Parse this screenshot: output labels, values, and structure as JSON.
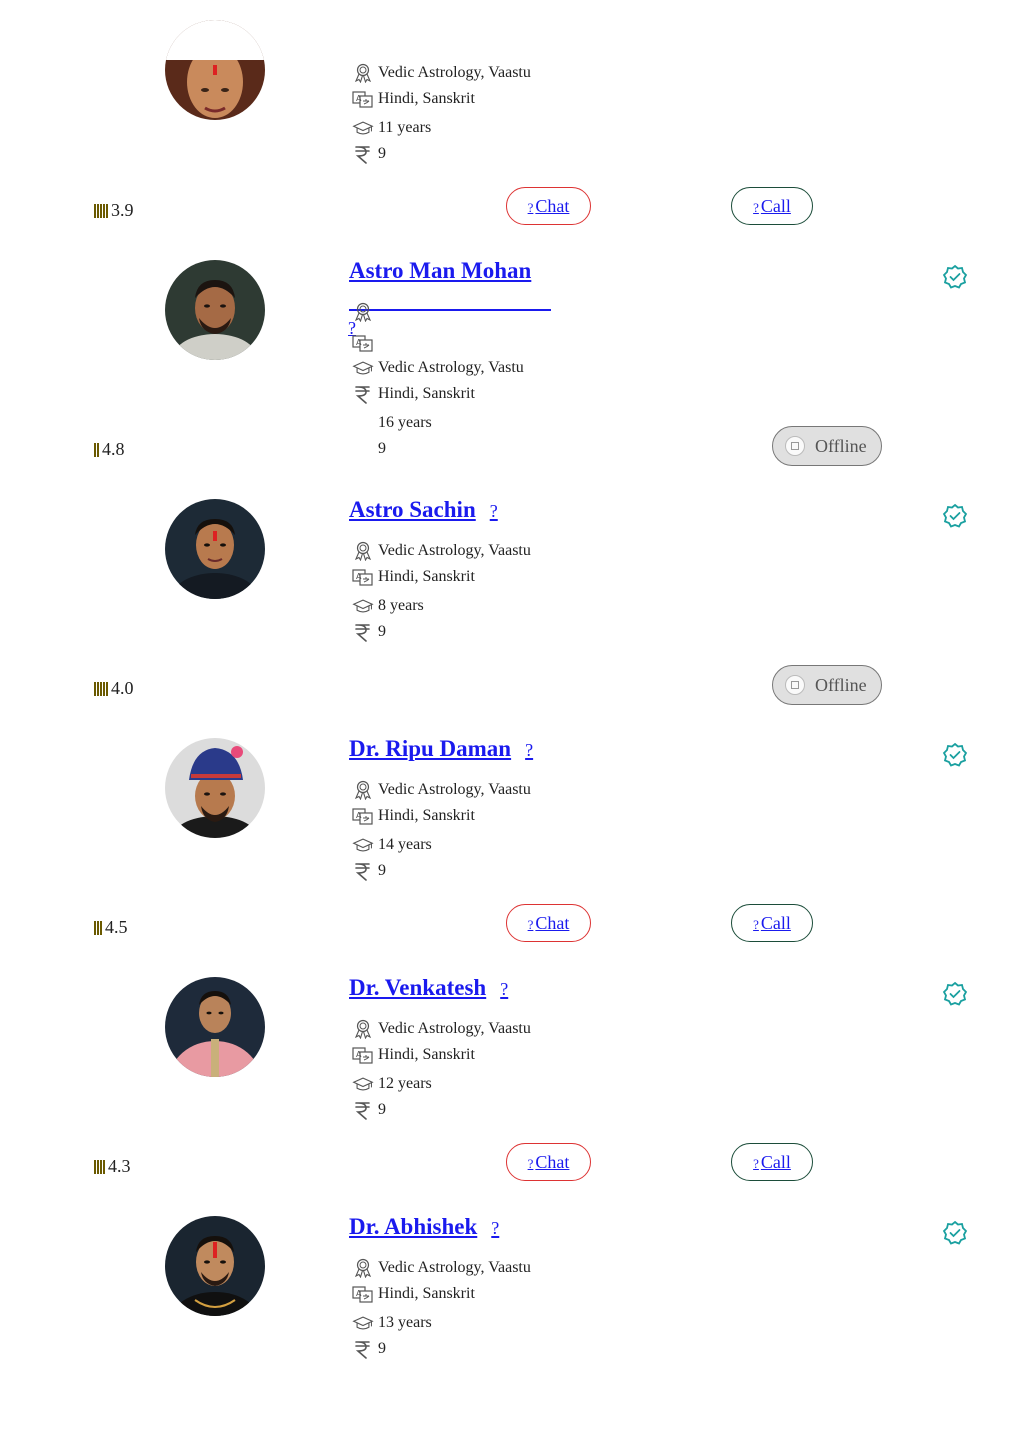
{
  "glyphs": {
    "tofu": "?"
  },
  "colors": {
    "link": "#1a1aee",
    "chat_border": "#dd3333",
    "call_border": "#1c4d3a",
    "verified": "#1aa0a0",
    "offline_bg": "#e0e0e0"
  },
  "card0": {
    "specialty": "Vedic Astrology, Vaastu",
    "languages": "Hindi, Sanskrit",
    "experience": "11 years",
    "price": "9",
    "rating": "3.9",
    "chat_label": "Chat",
    "call_label": "Call"
  },
  "card1": {
    "name": "Astro Man Mohan",
    "specialty": "Vedic Astrology, Vastu",
    "languages": "Hindi, Sanskrit",
    "experience": "16 years",
    "price": "9",
    "rating": "4.8",
    "status": "Offline"
  },
  "card2": {
    "name": "Astro Sachin",
    "specialty": "Vedic Astrology, Vaastu",
    "languages": "Hindi, Sanskrit",
    "experience": "8 years",
    "price": "9",
    "rating": "4.0",
    "status": "Offline"
  },
  "card3": {
    "name": "Dr. Ripu Daman",
    "specialty": "Vedic Astrology, Vaastu",
    "languages": "Hindi, Sanskrit",
    "experience": "14 years",
    "price": "9",
    "rating": "4.5",
    "chat_label": "Chat",
    "call_label": "Call"
  },
  "card4": {
    "name": "Dr. Venkatesh",
    "specialty": "Vedic Astrology, Vaastu",
    "languages": "Hindi, Sanskrit",
    "experience": "12 years",
    "price": "9",
    "rating": "4.3",
    "chat_label": "Chat",
    "call_label": "Call"
  },
  "card5": {
    "name": "Dr. Abhishek",
    "specialty": "Vedic Astrology, Vaastu",
    "languages": "Hindi, Sanskrit",
    "experience": "13 years",
    "price": "9"
  }
}
